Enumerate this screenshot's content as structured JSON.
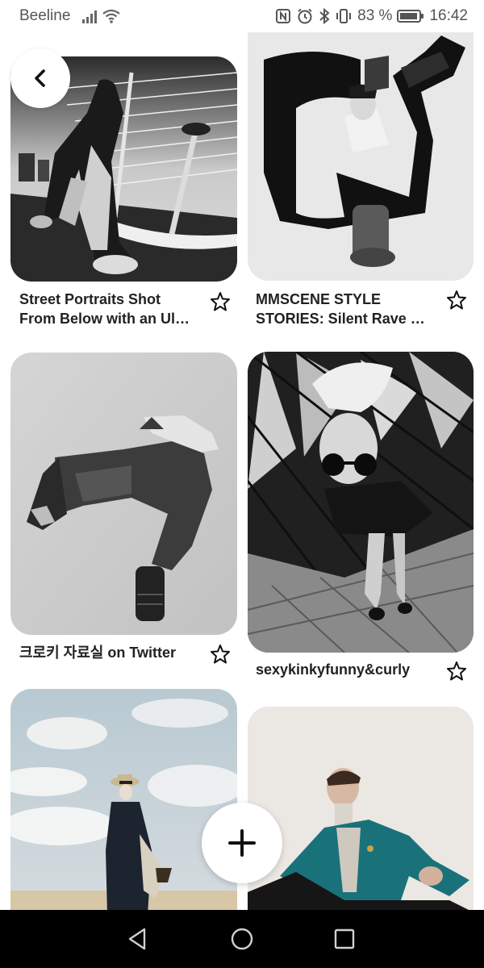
{
  "status_bar": {
    "carrier": "Beeline",
    "battery_percent": "83 %",
    "time": "16:42"
  },
  "icons": {
    "back": "chevron-left-icon",
    "add": "plus-icon",
    "save": "star-outline-icon",
    "nav_back": "triangle-back-icon",
    "nav_home": "circle-home-icon",
    "nav_recents": "square-recents-icon"
  },
  "pins": [
    {
      "title": "Street Portraits Shot From Below with an Ul…"
    },
    {
      "title": "MMSCENE STYLE STORIES: Silent Rave …"
    },
    {
      "title": "크로키 자료실 on Twitter"
    },
    {
      "title": "sexykinkyfunny&curly"
    },
    {
      "title": ""
    },
    {
      "title": ""
    }
  ],
  "colors": {
    "background": "#ffffff",
    "nav_bar": "#000000",
    "text": "#222222"
  }
}
